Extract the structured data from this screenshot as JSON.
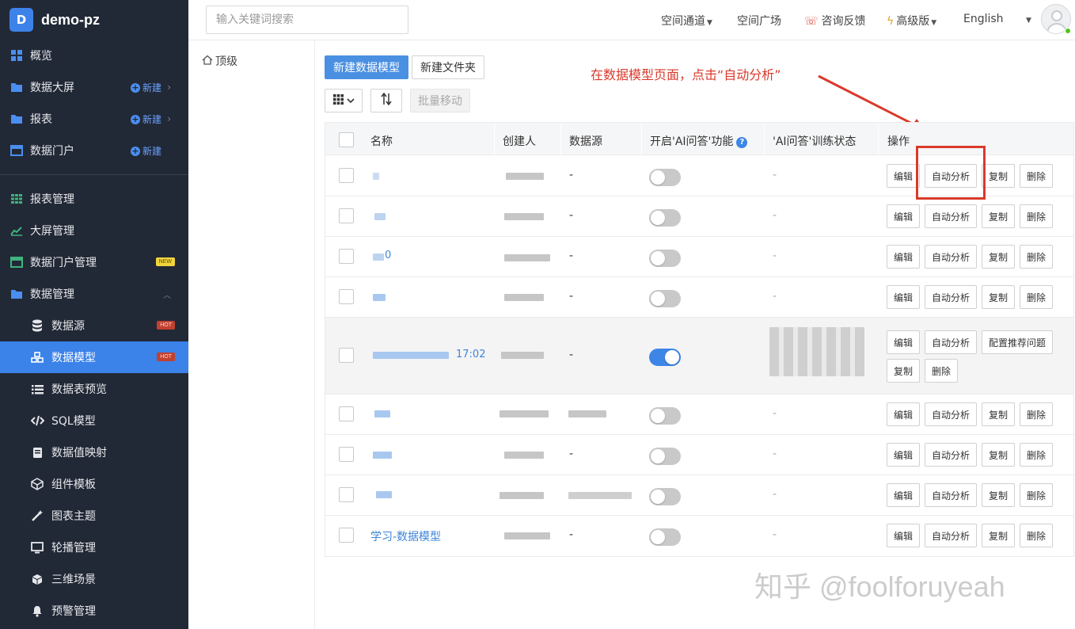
{
  "app": {
    "logo_letter": "D",
    "name": "demo-pz"
  },
  "sidebar": {
    "items": [
      {
        "label": "概览",
        "icon": "grid-icon"
      },
      {
        "label": "数据大屏",
        "icon": "folder-icon",
        "action": "新建"
      },
      {
        "label": "报表",
        "icon": "folder-icon",
        "action": "新建"
      },
      {
        "label": "数据门户",
        "icon": "window-icon",
        "action": "新建"
      },
      {
        "label": "报表管理",
        "icon": "table-icon"
      },
      {
        "label": "大屏管理",
        "icon": "line-chart-icon"
      },
      {
        "label": "数据门户管理",
        "icon": "window-icon",
        "badge": "NEW"
      },
      {
        "label": "数据管理",
        "icon": "folder-icon"
      },
      {
        "label": "数据源",
        "icon": "database-icon",
        "badge": "HOT"
      },
      {
        "label": "数据模型",
        "icon": "model-icon",
        "badge": "HOT"
      },
      {
        "label": "数据表预览",
        "icon": "list-icon"
      },
      {
        "label": "SQL模型",
        "icon": "code-icon"
      },
      {
        "label": "数据值映射",
        "icon": "book-icon"
      },
      {
        "label": "组件模板",
        "icon": "cube-outline-icon"
      },
      {
        "label": "图表主题",
        "icon": "magic-wand-icon"
      },
      {
        "label": "轮播管理",
        "icon": "monitor-icon"
      },
      {
        "label": "三维场景",
        "icon": "cube-icon"
      },
      {
        "label": "预警管理",
        "icon": "bell-icon"
      }
    ]
  },
  "topbar": {
    "search_placeholder": "输入关键词搜索",
    "nav": [
      "空间通道",
      "空间广场",
      "咨询反馈",
      "高级版",
      "English"
    ]
  },
  "folder": {
    "root": "顶级"
  },
  "toolbar": {
    "new_model": "新建数据模型",
    "new_folder": "新建文件夹",
    "batch_move": "批量移动"
  },
  "annotation": {
    "text": "在数据模型页面，点击“自动分析”",
    "color": "#d93a2b"
  },
  "table": {
    "columns": [
      "名称",
      "创建人",
      "数据源",
      "开启'AI问答'功能",
      "'AI问答'训练状态",
      "操作"
    ],
    "actions": {
      "edit": "编辑",
      "analyze": "自动分析",
      "copy": "复制",
      "delete": "删除",
      "config": "配置推荐问题"
    },
    "rows": [
      {
        "name": "",
        "datasource": "-",
        "ai_enabled": false,
        "train_status": "-"
      },
      {
        "name": "",
        "datasource": "-",
        "ai_enabled": false,
        "train_status": "-"
      },
      {
        "name": "0",
        "datasource": "-",
        "ai_enabled": false,
        "train_status": "-"
      },
      {
        "name": "",
        "datasource": "-",
        "ai_enabled": false,
        "train_status": "-"
      },
      {
        "name": "17:02",
        "datasource": "-",
        "ai_enabled": true,
        "train_status": ""
      },
      {
        "name": "",
        "datasource": "",
        "ai_enabled": false,
        "train_status": "-"
      },
      {
        "name": "",
        "datasource": "-",
        "ai_enabled": false,
        "train_status": "-"
      },
      {
        "name": "",
        "datasource": "",
        "ai_enabled": false,
        "train_status": "-"
      },
      {
        "name": "学习-数据模型",
        "datasource": "-",
        "ai_enabled": false,
        "train_status": "-"
      }
    ]
  },
  "watermark": "知乎 @foolforuyeah",
  "colors": {
    "sidebar_bg": "#222936",
    "accent": "#3b82e9",
    "annotation_red": "#d93a2b"
  }
}
